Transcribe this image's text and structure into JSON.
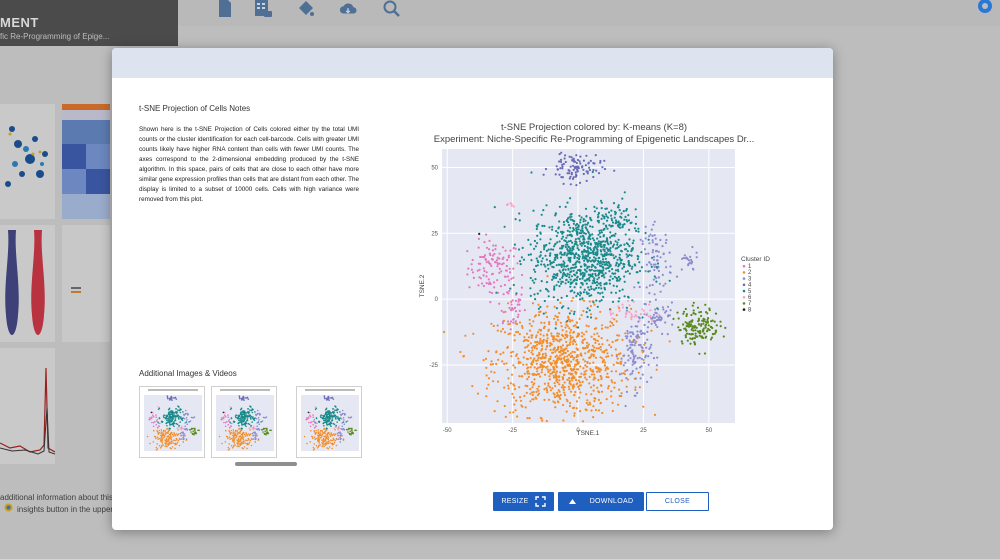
{
  "app": {
    "title": "MENT",
    "subtitle": "fic Re-Programming of Epige...",
    "bottom_text_1": "additional information about this p",
    "bottom_text_2": "insights button in the upper ri",
    "toolbar_icons": [
      "document-icon",
      "table-icon",
      "paint-bucket-icon",
      "cloud-download-icon",
      "zoom-icon"
    ]
  },
  "modal": {
    "notes_title": "t-SNE Projection of Cells Notes",
    "notes_body": "Shown here is the t-SNE Projection of Cells colored either by the total UMI counts or the cluster identification for each cell-barcode. Cells with greater UMI counts likely have higher RNA content than cells with fewer UMI counts. The axes correspond to the 2-dimensional embedding produced by the t-SNE algorithm. In this space, pairs of cells that are close to each other have more similar gene expression profiles than cells that are distant from each other. The display is limited to a subset of 10000 cells. Cells with high variance were removed from this plot.",
    "additional_title": "Additional Images & Videos",
    "buttons": {
      "resize": "RESIZE",
      "download": "DOWNLOAD",
      "close": "CLOSE"
    }
  },
  "colors": {
    "primary": "#1f5fc0",
    "header_bg": "#dde3ef",
    "plot_bg": "#e5e8f2"
  },
  "chart_data": {
    "type": "scatter",
    "title": "t-SNE Projection colored by:  K-means (K=8)",
    "subtitle": "Experiment: Niche-Specific Re-Programming of Epigenetic Landscapes Dr...",
    "xlabel": "TSNE.1",
    "ylabel": "TSNE.2",
    "xlim": [
      -52,
      60
    ],
    "ylim": [
      -47,
      57
    ],
    "x_ticks": [
      -50,
      -25,
      0,
      25,
      50
    ],
    "y_ticks": [
      50,
      25,
      0,
      -25
    ],
    "legend_title": "Cluster ID",
    "legend_position": "right",
    "grid": true,
    "series": [
      {
        "name": "1",
        "color": "#e377c2",
        "clusters": [
          {
            "cx": -32,
            "cy": 12,
            "sx": 5,
            "sy": 5,
            "n": 110
          },
          {
            "cx": -26,
            "cy": -3,
            "sx": 3,
            "sy": 5,
            "n": 40
          }
        ]
      },
      {
        "name": "2",
        "color": "#f28e2b",
        "clusters": [
          {
            "cx": -6,
            "cy": -24,
            "sx": 13,
            "sy": 10,
            "n": 900
          }
        ]
      },
      {
        "name": "3",
        "color": "#8c8ccf",
        "clusters": [
          {
            "cx": 30,
            "cy": 15,
            "sx": 3,
            "sy": 6,
            "n": 80
          },
          {
            "cx": 22,
            "cy": -20,
            "sx": 3,
            "sy": 7,
            "n": 110
          },
          {
            "cx": 31,
            "cy": -7,
            "sx": 3,
            "sy": 2.5,
            "n": 50
          },
          {
            "cx": 42,
            "cy": 14,
            "sx": 2,
            "sy": 2,
            "n": 22
          }
        ]
      },
      {
        "name": "4",
        "color": "#6a6ab8",
        "clusters": [
          {
            "cx": -1,
            "cy": 50,
            "sx": 5,
            "sy": 3,
            "n": 100
          }
        ]
      },
      {
        "name": "5",
        "color": "#1a8a8a",
        "clusters": [
          {
            "cx": 2,
            "cy": 16,
            "sx": 10,
            "sy": 9,
            "n": 900
          },
          {
            "cx": 15,
            "cy": 31,
            "sx": 3,
            "sy": 3,
            "n": 55
          }
        ]
      },
      {
        "name": "6",
        "color": "#f4a6c8",
        "clusters": [
          {
            "cx": 20,
            "cy": -5,
            "sx": 5,
            "sy": 2,
            "n": 40
          },
          {
            "cx": -25,
            "cy": 36,
            "sx": 1,
            "sy": 0.5,
            "n": 6
          }
        ]
      },
      {
        "name": "7",
        "color": "#5a8a1f",
        "clusters": [
          {
            "cx": 46,
            "cy": -10,
            "sx": 4,
            "sy": 3.5,
            "n": 150
          }
        ]
      },
      {
        "name": "8",
        "color": "#222222",
        "clusters": [
          {
            "cx": -38,
            "cy": 25,
            "sx": 0.3,
            "sy": 0.3,
            "n": 1
          }
        ]
      }
    ]
  }
}
